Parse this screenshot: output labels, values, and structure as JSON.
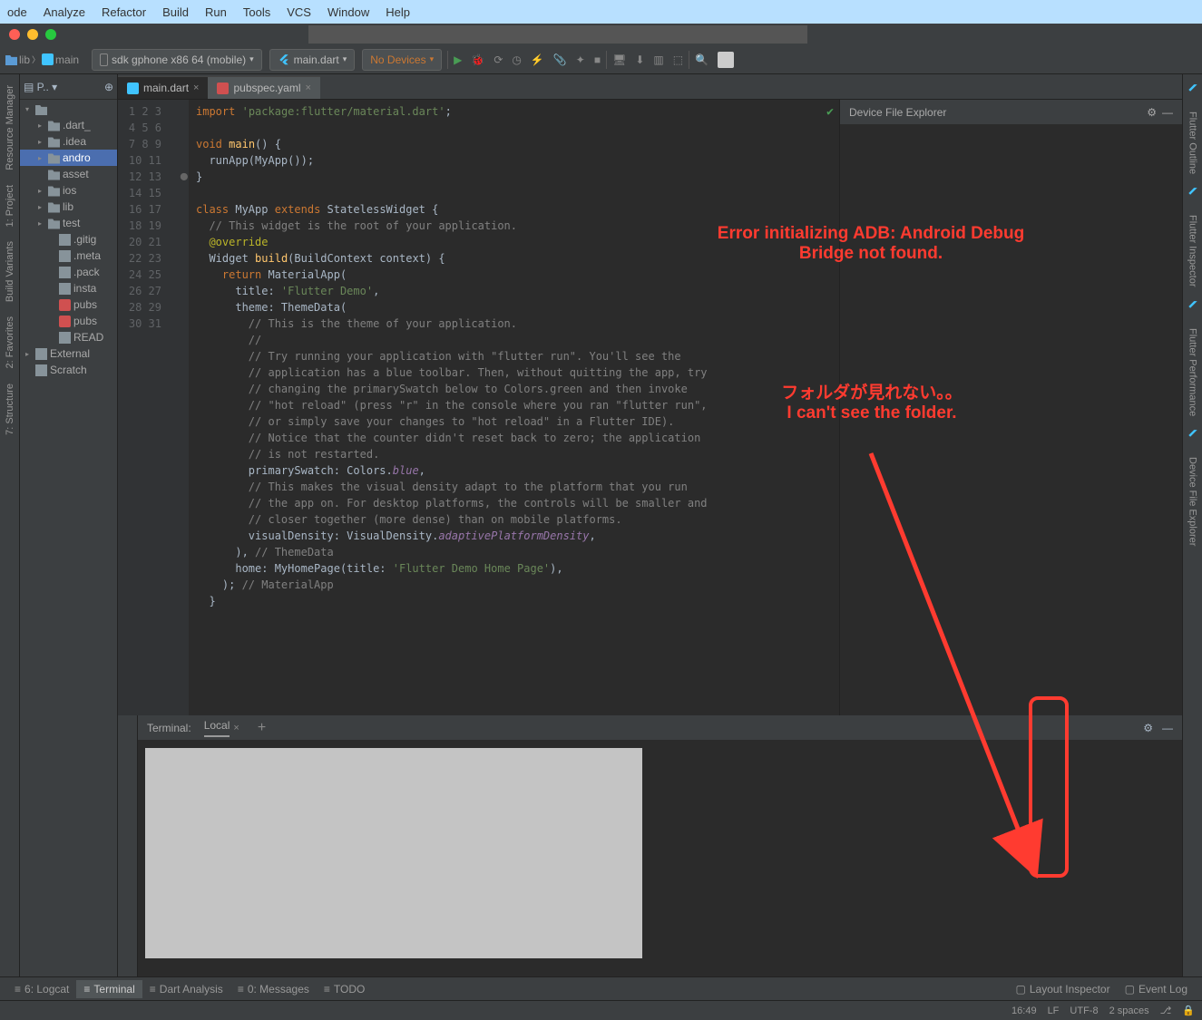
{
  "menubar": [
    "ode",
    "Analyze",
    "Refactor",
    "Build",
    "Run",
    "Tools",
    "VCS",
    "Window",
    "Help"
  ],
  "breadcrumb": {
    "lib": "lib",
    "main": "main"
  },
  "runconfig": {
    "device": "sdk gphone x86 64 (mobile)",
    "target": "main.dart",
    "devices": "No Devices"
  },
  "projectPanel": {
    "title": "P.."
  },
  "projectTree": [
    {
      "lvl": 0,
      "arrow": "▾",
      "icon": "folder",
      "label": ""
    },
    {
      "lvl": 1,
      "arrow": "▸",
      "icon": "folder",
      "label": ".dart_"
    },
    {
      "lvl": 1,
      "arrow": "▸",
      "icon": "folder",
      "label": ".idea"
    },
    {
      "lvl": 1,
      "arrow": "▸",
      "icon": "folder",
      "label": "andro",
      "sel": true
    },
    {
      "lvl": 1,
      "arrow": "",
      "icon": "folder",
      "label": "asset"
    },
    {
      "lvl": 1,
      "arrow": "▸",
      "icon": "folder",
      "label": "ios"
    },
    {
      "lvl": 1,
      "arrow": "▸",
      "icon": "folder",
      "label": "lib"
    },
    {
      "lvl": 1,
      "arrow": "▸",
      "icon": "folder",
      "label": "test"
    },
    {
      "lvl": 2,
      "arrow": "",
      "icon": "file",
      "label": ".gitig"
    },
    {
      "lvl": 2,
      "arrow": "",
      "icon": "file",
      "label": ".meta"
    },
    {
      "lvl": 2,
      "arrow": "",
      "icon": "file",
      "label": ".pack"
    },
    {
      "lvl": 2,
      "arrow": "",
      "icon": "file",
      "label": "insta"
    },
    {
      "lvl": 2,
      "arrow": "",
      "icon": "yml",
      "label": "pubs"
    },
    {
      "lvl": 2,
      "arrow": "",
      "icon": "yml",
      "label": "pubs"
    },
    {
      "lvl": 2,
      "arrow": "",
      "icon": "file",
      "label": "READ"
    },
    {
      "lvl": 0,
      "arrow": "▸",
      "icon": "lib",
      "label": "External"
    },
    {
      "lvl": 0,
      "arrow": "",
      "icon": "scratch",
      "label": "Scratch"
    }
  ],
  "tabs": [
    {
      "icon": "dart",
      "label": "main.dart",
      "active": true
    },
    {
      "icon": "yml",
      "label": "pubspec.yaml",
      "active": false
    }
  ],
  "lineStart": 1,
  "lineCount": 31,
  "code": [
    {
      "t": "<kw>import</kw> <str>'package:flutter/material.dart'</str>;"
    },
    {
      "t": ""
    },
    {
      "t": "<kw>void</kw> <fn>main</fn>() {"
    },
    {
      "t": "  runApp(<cls>MyApp</cls>());"
    },
    {
      "t": "}"
    },
    {
      "t": ""
    },
    {
      "t": "<kw>class</kw> <cls>MyApp</cls> <kw>extends</kw> <cls>StatelessWidget</cls> {"
    },
    {
      "t": "  <cmt>// This widget is the root of your application.</cmt>"
    },
    {
      "t": "  <ann>@override</ann>"
    },
    {
      "t": "  <cls>Widget</cls> <fn>build</fn>(<cls>BuildContext</cls> context) {"
    },
    {
      "t": "    <kw>return</kw> <cls>MaterialApp</cls>("
    },
    {
      "t": "      title: <str>'Flutter Demo'</str>,"
    },
    {
      "t": "      theme: <cls>ThemeData</cls>("
    },
    {
      "t": "        <cmt>// This is the theme of your application.</cmt>"
    },
    {
      "t": "        <cmt>//</cmt>"
    },
    {
      "t": "        <cmt>// Try running your application with \"flutter run\". You'll see the</cmt>"
    },
    {
      "t": "        <cmt>// application has a blue toolbar. Then, without quitting the app, try</cmt>"
    },
    {
      "t": "        <cmt>// changing the primarySwatch below to Colors.green and then invoke</cmt>"
    },
    {
      "t": "        <cmt>// \"hot reload\" (press \"r\" in the console where you ran \"flutter run\",</cmt>"
    },
    {
      "t": "        <cmt>// or simply save your changes to \"hot reload\" in a Flutter IDE).</cmt>"
    },
    {
      "t": "        <cmt>// Notice that the counter didn't reset back to zero; the application</cmt>"
    },
    {
      "t": "        <cmt>// is not restarted.</cmt>"
    },
    {
      "t": "        primarySwatch: <cls>Colors</cls>.<prop>blue</prop>,"
    },
    {
      "t": "        <cmt>// This makes the visual density adapt to the platform that you run</cmt>"
    },
    {
      "t": "        <cmt>// the app on. For desktop platforms, the controls will be smaller and</cmt>"
    },
    {
      "t": "        <cmt>// closer together (more dense) than on mobile platforms.</cmt>"
    },
    {
      "t": "        visualDensity: <cls>VisualDensity</cls>.<prop>adaptivePlatformDensity</prop>,"
    },
    {
      "t": "      ), <cmt>// ThemeData</cmt>"
    },
    {
      "t": "      home: <cls>MyHomePage</cls>(title: <str>'Flutter Demo Home Page'</str>),"
    },
    {
      "t": "    ); <cmt>// MaterialApp</cmt>"
    },
    {
      "t": "  }"
    }
  ],
  "dfe": {
    "title": "Device File Explorer"
  },
  "annotations": {
    "error1": "Error initializing ADB: Android Debug",
    "error2": "Bridge not found.",
    "jp": "フォルダが見れない。。",
    "en": "I can't see the folder."
  },
  "terminal": {
    "label": "Terminal:",
    "tab": "Local"
  },
  "leftRail": [
    "Resource Manager",
    "1: Project",
    "Build Variants",
    "2: Favorites",
    "7: Structure"
  ],
  "rightRail": [
    "Flutter Outline",
    "Flutter Inspector",
    "Flutter Performance",
    "Device File Explorer"
  ],
  "bottombar": {
    "items": [
      "6: Logcat",
      "Terminal",
      "Dart Analysis",
      "0: Messages",
      "TODO"
    ],
    "right": [
      "Layout Inspector",
      "Event Log"
    ],
    "activeIndex": 1
  },
  "statusbar": {
    "pos": "16:49",
    "eol": "LF",
    "enc": "UTF-8",
    "indent": "2 spaces"
  }
}
